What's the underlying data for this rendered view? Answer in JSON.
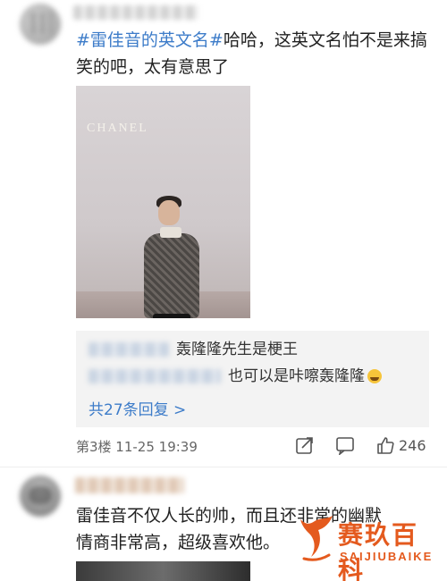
{
  "comment1": {
    "hashtag": "#雷佳音的英文名#",
    "text": "哈哈，这英文名怕不是来搞笑的吧，太有意思了",
    "photo_brand": "CHANEL"
  },
  "replies": {
    "items": [
      {
        "text": "轰隆隆先生是梗王"
      },
      {
        "text": "也可以是咔嚓轰隆隆"
      }
    ],
    "more": "共27条回复 >"
  },
  "footer": {
    "floor_time": "第3楼  11-25 19:39",
    "like_count": "246"
  },
  "comment2": {
    "text_line1": "雷佳音不仅人长的帅，而且还非常的幽默",
    "text_line2": "情商非常高，超级喜欢他。"
  },
  "watermark": {
    "brand_cn": "赛玖百科",
    "brand_en": "SAIJIUBAIKE",
    "color": "#e45a1e"
  },
  "icons": [
    "share-icon",
    "comment-icon",
    "thumbs-up-icon",
    "laugh-emoji-icon"
  ]
}
